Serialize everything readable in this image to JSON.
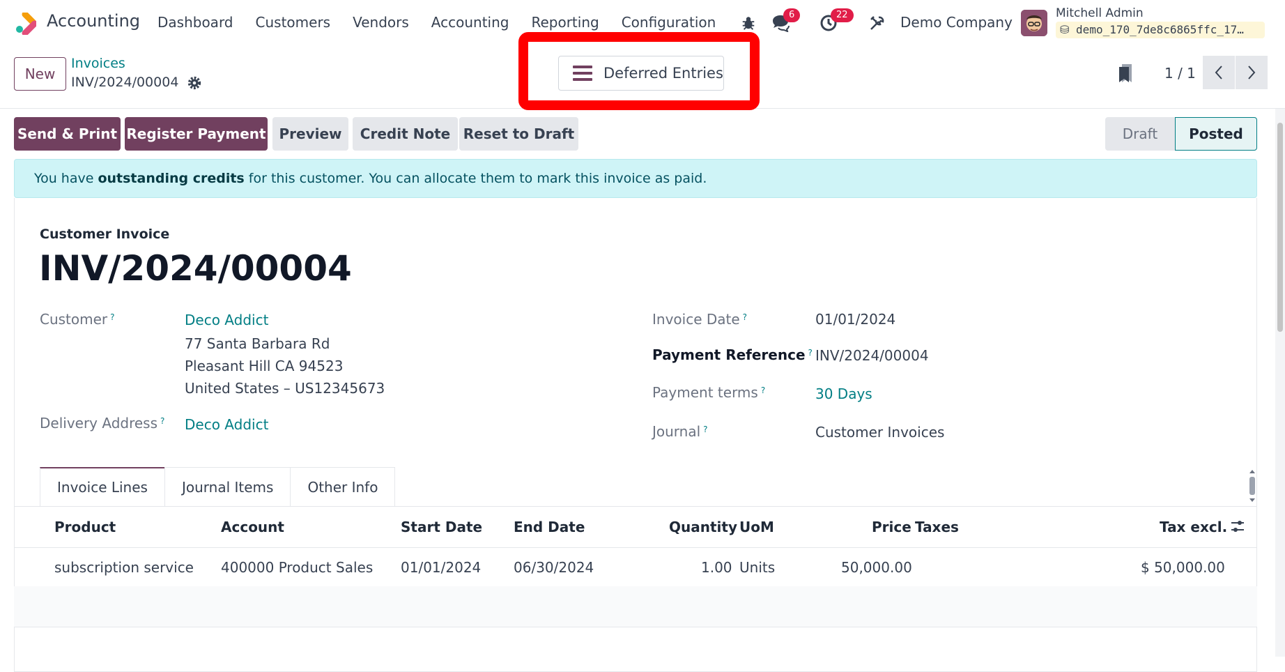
{
  "navbar": {
    "app_title": "Accounting",
    "menu": [
      "Dashboard",
      "Customers",
      "Vendors",
      "Accounting",
      "Reporting",
      "Configuration"
    ],
    "messages_count": "6",
    "activities_count": "22",
    "company": "Demo Company",
    "user_name": "Mitchell Admin",
    "database": "demo_170_7de8c6865ffc_17…"
  },
  "control": {
    "new_label": "New",
    "breadcrumb_parent": "Invoices",
    "breadcrumb_current": "INV/2024/00004",
    "deferred_label": "Deferred Entries",
    "pager": "1 / 1"
  },
  "actions": {
    "send_print": "Send & Print",
    "register_payment": "Register Payment",
    "preview": "Preview",
    "credit_note": "Credit Note",
    "reset_draft": "Reset to Draft"
  },
  "status": {
    "draft": "Draft",
    "posted": "Posted"
  },
  "alert": {
    "prefix": "You have ",
    "strong": "outstanding credits",
    "suffix": " for this customer. You can allocate them to mark this invoice as paid."
  },
  "invoice": {
    "type": "Customer Invoice",
    "name": "INV/2024/00004",
    "customer_label": "Customer",
    "customer": "Deco Addict",
    "address_line1": "77 Santa Barbara Rd",
    "address_line2": "Pleasant Hill CA 94523",
    "address_line3": "United States – US12345673",
    "delivery_label": "Delivery Address",
    "delivery": "Deco Addict",
    "invoice_date_label": "Invoice Date",
    "invoice_date": "01/01/2024",
    "payment_ref_label": "Payment Reference",
    "payment_ref": "INV/2024/00004",
    "payment_terms_label": "Payment terms",
    "payment_terms": "30 Days",
    "journal_label": "Journal",
    "journal": "Customer Invoices"
  },
  "tabs": [
    "Invoice Lines",
    "Journal Items",
    "Other Info"
  ],
  "table": {
    "headers": {
      "product": "Product",
      "account": "Account",
      "start": "Start Date",
      "end": "End Date",
      "quantity": "Quantity",
      "uom": "UoM",
      "price": "Price",
      "taxes": "Taxes",
      "tax_excl": "Tax excl."
    },
    "row": {
      "product": "subscription service",
      "account": "400000 Product Sales",
      "start": "01/01/2024",
      "end": "06/30/2024",
      "quantity": "1.00",
      "uom": "Units",
      "price": "50,000.00",
      "taxes": "",
      "tax_excl": "$ 50,000.00"
    }
  },
  "colors": {
    "brand": "#71405f",
    "link": "#017e84",
    "highlight": "#ff0000"
  }
}
